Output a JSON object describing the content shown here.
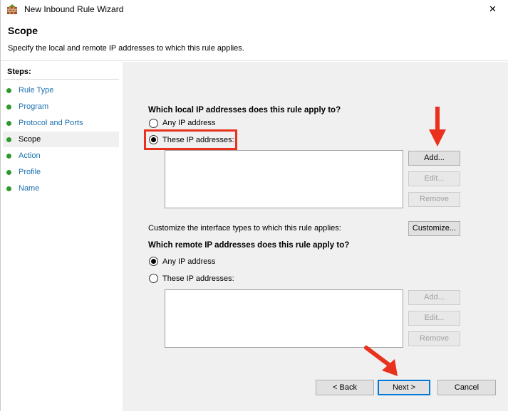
{
  "window": {
    "title": "New Inbound Rule Wizard",
    "close_glyph": "✕"
  },
  "header": {
    "heading": "Scope",
    "description": "Specify the local and remote IP addresses to which this rule applies."
  },
  "steps": {
    "title": "Steps:",
    "items": [
      {
        "label": "Rule Type",
        "current": false
      },
      {
        "label": "Program",
        "current": false
      },
      {
        "label": "Protocol and Ports",
        "current": false
      },
      {
        "label": "Scope",
        "current": true
      },
      {
        "label": "Action",
        "current": false
      },
      {
        "label": "Profile",
        "current": false
      },
      {
        "label": "Name",
        "current": false
      }
    ]
  },
  "local": {
    "heading": "Which local IP addresses does this rule apply to?",
    "any_label": "Any IP address",
    "these_label": "These IP addresses:",
    "selected": "these",
    "add_label": "Add...",
    "edit_label": "Edit...",
    "remove_label": "Remove"
  },
  "interface": {
    "text": "Customize the interface types to which this rule applies:",
    "button_label": "Customize..."
  },
  "remote": {
    "heading": "Which remote IP addresses does this rule apply to?",
    "any_label": "Any IP address",
    "these_label": "These IP addresses:",
    "selected": "any",
    "add_label": "Add...",
    "edit_label": "Edit...",
    "remove_label": "Remove"
  },
  "nav": {
    "back_label": "< Back",
    "next_label": "Next >",
    "cancel_label": "Cancel"
  },
  "icons": {
    "app": "firewall-wall-icon",
    "close": "close-icon",
    "step_bullet": "green-dot-icon",
    "annotation_arrow": "red-arrow-icon"
  },
  "colors": {
    "step_link": "#1a6fb0",
    "step_dot": "#2b9a2b",
    "annotation": "#e8321e",
    "default_button_border": "#0078d7",
    "content_bg": "#f0f0f0"
  }
}
